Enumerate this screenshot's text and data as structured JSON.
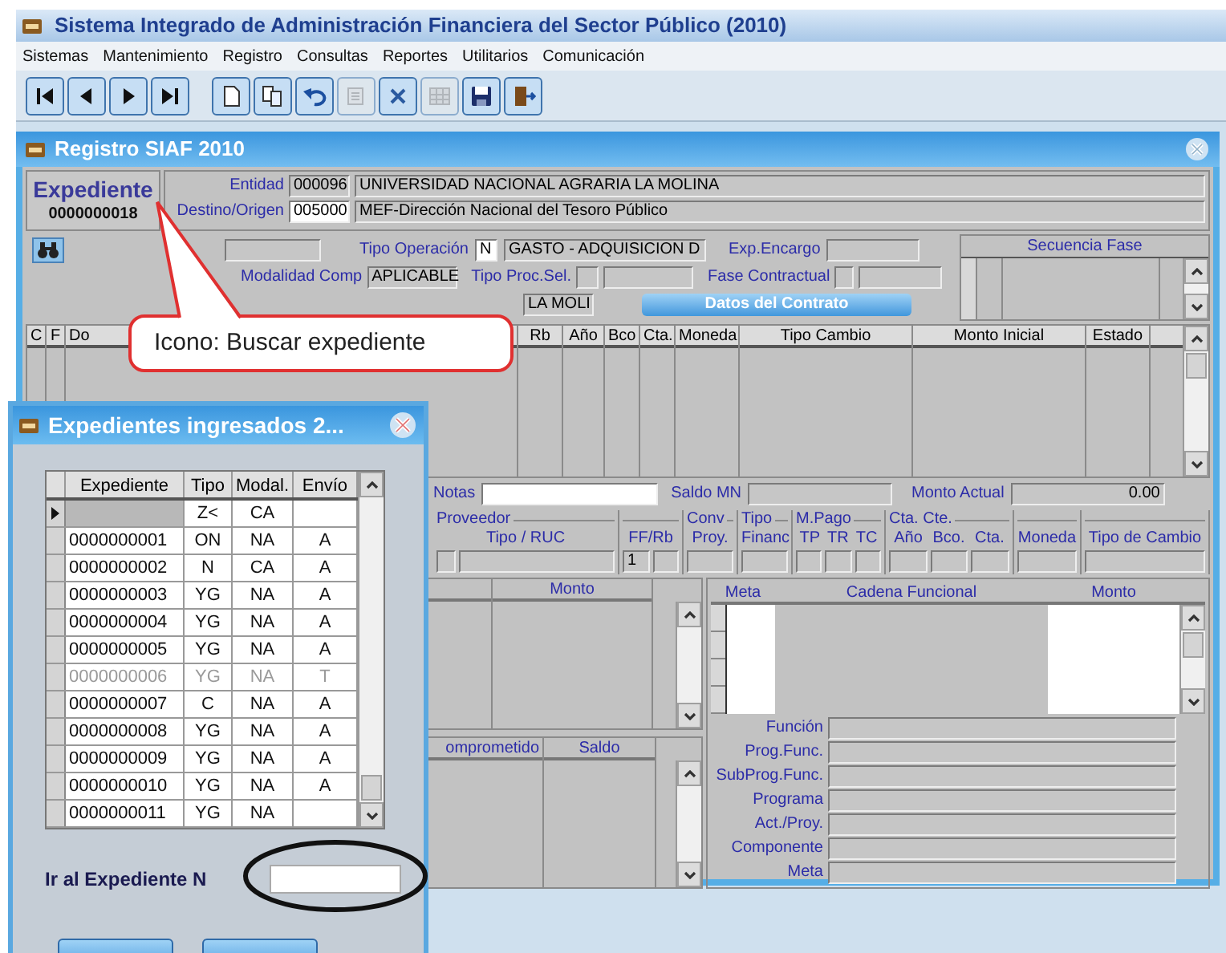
{
  "app_window": {
    "title": "Sistema Integrado de Administración Financiera del Sector Público (2010)"
  },
  "menu": [
    "Sistemas",
    "Mantenimiento",
    "Registro",
    "Consultas",
    "Reportes",
    "Utilitarios",
    "Comunicación"
  ],
  "toolbar": {
    "navigation": [
      {
        "kind": "first",
        "disabled": false
      },
      {
        "kind": "prev",
        "disabled": false
      },
      {
        "kind": "next",
        "disabled": false
      },
      {
        "kind": "last",
        "disabled": false
      }
    ],
    "actions": [
      {
        "kind": "new",
        "disabled": false
      },
      {
        "kind": "copy",
        "disabled": false
      },
      {
        "kind": "undo",
        "disabled": false
      },
      {
        "kind": "edit",
        "disabled": true
      },
      {
        "kind": "cancel",
        "disabled": false
      },
      {
        "kind": "grid",
        "disabled": true
      },
      {
        "kind": "save",
        "disabled": false
      },
      {
        "kind": "exit",
        "disabled": false
      }
    ]
  },
  "form": {
    "title": "Registro SIAF 2010",
    "expediente": {
      "label": "Expediente",
      "number": "0000000018"
    },
    "entidad": {
      "label": "Entidad",
      "code": "000096",
      "name": "UNIVERSIDAD NACIONAL AGRARIA LA MOLINA"
    },
    "destino": {
      "label": "Destino/Origen",
      "code": "005000",
      "name": "MEF-Dirección Nacional del Tesoro Público"
    },
    "tipo_operacion": {
      "label": "Tipo Operación",
      "code": "N",
      "name": "GASTO - ADQUISICION D"
    },
    "exp_encargo": {
      "label": "Exp.Encargo"
    },
    "modalidad": {
      "label": "Modalidad Comp",
      "value": "APLICABLE"
    },
    "tipo_proc_sel": {
      "label": "Tipo Proc.Sel."
    },
    "fase_contractual": {
      "label": "Fase Contractual"
    },
    "field_3": "LA MOLI",
    "contract_button": "Datos del Contrato",
    "secuencia_fase": {
      "title": "Secuencia Fase"
    },
    "grid": {
      "columns": [
        "C",
        "F",
        "Do",
        "Rb",
        "Año",
        "Bco",
        "Cta.",
        "Moneda",
        "Tipo Cambio",
        "Monto Inicial",
        "Estado"
      ]
    },
    "notas": {
      "label": "Notas"
    },
    "saldo_mn": {
      "label": "Saldo MN"
    },
    "monto_actual": {
      "label": "Monto Actual",
      "value": "0.00"
    },
    "payment_groups": [
      {
        "title": "Proveedor",
        "sublabels": [
          "Tipo / RUC"
        ],
        "fields": [
          {
            "kind": "narrow"
          },
          {
            "kind": "wide"
          }
        ]
      },
      {
        "sublabels": [
          "FF/Rb"
        ],
        "fields": [
          {
            "kind": "wide",
            "value": "1"
          },
          {
            "kind": "wide"
          }
        ]
      },
      {
        "title": "Conv",
        "sublabels": [
          "Proy."
        ],
        "fields": [
          {
            "kind": "wide"
          }
        ]
      },
      {
        "title": "Tipo",
        "sublabels": [
          "Financ"
        ],
        "fields": [
          {
            "kind": "wide"
          }
        ]
      },
      {
        "title": "M.Pago",
        "sublabels": [
          "TP",
          "TR",
          "TC"
        ],
        "fields": [
          {
            "kind": "wide"
          },
          {
            "kind": "wide"
          },
          {
            "kind": "wide"
          }
        ]
      },
      {
        "title": "Cta. Cte.",
        "sublabels": [
          "Año",
          "Bco.",
          "Cta."
        ],
        "fields": [
          {
            "kind": "wide"
          },
          {
            "kind": "wide"
          },
          {
            "kind": "wide"
          }
        ]
      },
      {
        "sublabels": [
          "Moneda"
        ],
        "fields": [
          {
            "kind": "wide"
          }
        ]
      },
      {
        "sublabels": [
          "Tipo de Cambio"
        ],
        "fields": [
          {
            "kind": "wide"
          }
        ]
      }
    ],
    "amount_grid": {
      "columns": [
        "Monto"
      ]
    },
    "balance_grid": {
      "columns": [
        "omprometido",
        "Saldo"
      ]
    },
    "meta_grid": {
      "columns": [
        "Meta",
        "Cadena Funcional",
        "Monto"
      ]
    },
    "funcional_fields": [
      "Función",
      "Prog.Func.",
      "SubProg.Func.",
      "Programa",
      "Act./Proy.",
      "Componente",
      "Meta"
    ]
  },
  "dialog": {
    "title": "Expedientes ingresados 2...",
    "columns": [
      "Expediente",
      "Tipo",
      "Modal.",
      "Envío"
    ],
    "rows": [
      {
        "tipo": "Z<",
        "modal": "CA",
        "current": true,
        "disabled": false
      },
      {
        "expediente": "0000000001",
        "tipo": "ON",
        "modal": "NA",
        "envio": "A",
        "current": false,
        "disabled": false
      },
      {
        "expediente": "0000000002",
        "tipo": "N",
        "modal": "CA",
        "envio": "A",
        "current": false,
        "disabled": false
      },
      {
        "expediente": "0000000003",
        "tipo": "YG",
        "modal": "NA",
        "envio": "A",
        "current": false,
        "disabled": false
      },
      {
        "expediente": "0000000004",
        "tipo": "YG",
        "modal": "NA",
        "envio": "A",
        "current": false,
        "disabled": false
      },
      {
        "expediente": "0000000005",
        "tipo": "YG",
        "modal": "NA",
        "envio": "A",
        "current": false,
        "disabled": false
      },
      {
        "expediente": "0000000006",
        "tipo": "YG",
        "modal": "NA",
        "envio": "T",
        "current": false,
        "disabled": true
      },
      {
        "expediente": "0000000007",
        "tipo": "C",
        "modal": "NA",
        "envio": "A",
        "current": false,
        "disabled": false
      },
      {
        "expediente": "0000000008",
        "tipo": "YG",
        "modal": "NA",
        "envio": "A",
        "current": false,
        "disabled": false
      },
      {
        "expediente": "0000000009",
        "tipo": "YG",
        "modal": "NA",
        "envio": "A",
        "current": false,
        "disabled": false
      },
      {
        "expediente": "0000000010",
        "tipo": "YG",
        "modal": "NA",
        "envio": "A",
        "current": false,
        "disabled": false
      },
      {
        "expediente": "0000000011",
        "tipo": "YG",
        "modal": "NA",
        "current": false,
        "disabled": false
      }
    ],
    "goto_label": "Ir al Expediente N"
  },
  "callout": {
    "text": "Icono: Buscar expediente"
  }
}
